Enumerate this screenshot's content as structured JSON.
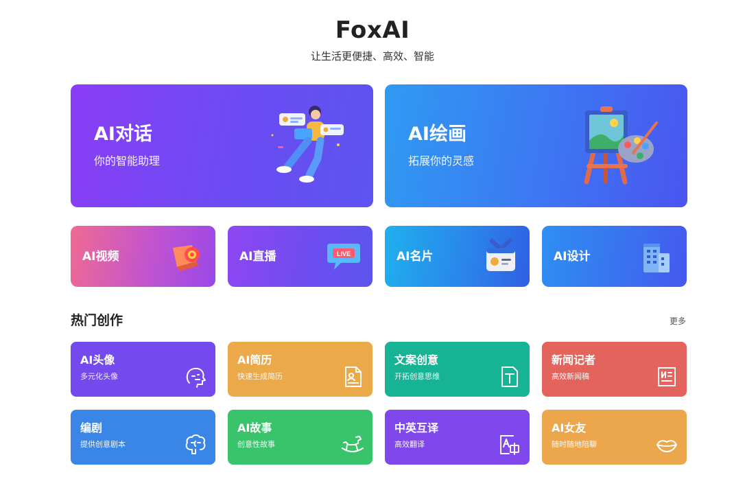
{
  "header": {
    "title": "FoxAI",
    "subtitle": "让生活更便捷、高效、智能"
  },
  "feature_cards": [
    {
      "title": "AI对话",
      "subtitle": "你的智能助理",
      "icon": "person-chat-illustration"
    },
    {
      "title": "AI绘画",
      "subtitle": "拓展你的灵感",
      "icon": "easel-palette-illustration"
    }
  ],
  "quick_cards": [
    {
      "title": "AI视频",
      "icon": "video-camera-icon"
    },
    {
      "title": "AI直播",
      "icon": "live-bubble-icon"
    },
    {
      "title": "AI名片",
      "icon": "id-badge-icon"
    },
    {
      "title": "AI设计",
      "icon": "building-icon"
    }
  ],
  "section": {
    "title": "热门创作",
    "more": "更多"
  },
  "tools": [
    {
      "title": "AI头像",
      "subtitle": "多元化头像",
      "icon": "face-icon",
      "color": "#7449ee"
    },
    {
      "title": "AI简历",
      "subtitle": "快速生成简历",
      "icon": "resume-icon",
      "color": "#eba94a"
    },
    {
      "title": "文案创意",
      "subtitle": "开拓创意思维",
      "icon": "text-doc-icon",
      "color": "#16b395"
    },
    {
      "title": "新闻记者",
      "subtitle": "高效新闻稿",
      "icon": "newspaper-icon",
      "color": "#e2645c"
    },
    {
      "title": "编剧",
      "subtitle": "提供创意剧本",
      "icon": "brain-icon",
      "color": "#3a86e6"
    },
    {
      "title": "AI故事",
      "subtitle": "创意性故事",
      "icon": "rocking-horse-icon",
      "color": "#39c46b"
    },
    {
      "title": "中英互译",
      "subtitle": "高效翻译",
      "icon": "translate-icon",
      "color": "#8048ec"
    },
    {
      "title": "AI女友",
      "subtitle": "随时随地陪聊",
      "icon": "lips-icon",
      "color": "#eca64c"
    }
  ]
}
